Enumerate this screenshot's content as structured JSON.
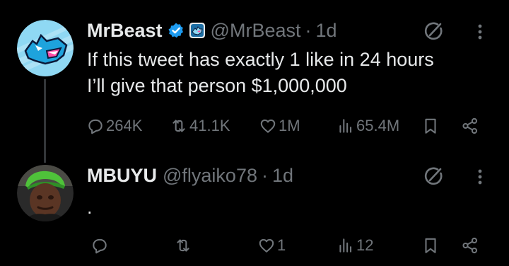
{
  "tweets": [
    {
      "name": "MrBeast",
      "handle": "@MrBeast",
      "separator": "·",
      "time": "1d",
      "text_lines": [
        "If this tweet has exactly 1 like in 24 hours",
        "I’ll give that person $1,000,000"
      ],
      "verified": true,
      "affiliate_badge": true,
      "avatar_icon": "mrbeast-panther-logo",
      "counts": {
        "replies": "264K",
        "reposts": "41.1K",
        "likes": "1M",
        "views": "65.4M"
      }
    },
    {
      "name": "MBUYU",
      "handle": "@flyaiko78",
      "separator": "·",
      "time": "1d",
      "text_lines": [
        "."
      ],
      "verified": false,
      "affiliate_badge": false,
      "avatar_icon": "user-photo-avatar",
      "counts": {
        "replies": "",
        "reposts": "",
        "likes": "1",
        "views": "12"
      }
    }
  ],
  "colors": {
    "background": "#000000",
    "text": "#e7e9ea",
    "secondary": "#71767b",
    "verified_blue": "#1d9bf0",
    "thread_line": "#333639"
  },
  "icons": [
    "verified-badge-icon",
    "grok-icon",
    "more-icon",
    "reply-icon",
    "repost-icon",
    "like-icon",
    "views-icon",
    "bookmark-icon",
    "share-icon"
  ]
}
